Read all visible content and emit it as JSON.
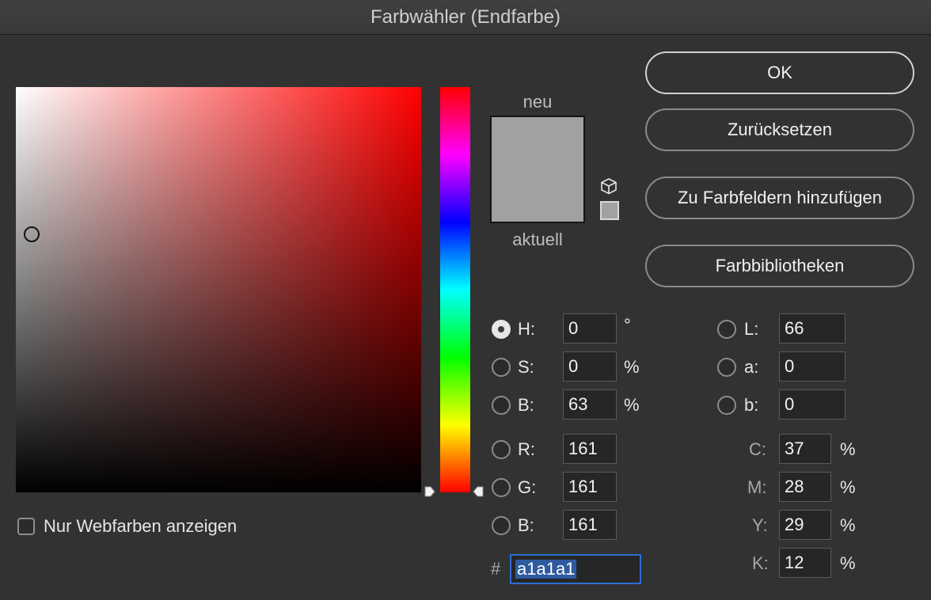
{
  "window": {
    "title": "Farbwähler (Endfarbe)"
  },
  "preview": {
    "new_label": "neu",
    "current_label": "aktuell",
    "new_color": "#a1a1a1",
    "current_color": "#a1a1a1"
  },
  "buttons": {
    "ok": "OK",
    "reset": "Zurücksetzen",
    "add_to_swatches": "Zu Farbfeldern hinzufügen",
    "color_libraries": "Farbbibliotheken"
  },
  "hsb": {
    "h": {
      "label": "H:",
      "value": "0",
      "unit": "°"
    },
    "s": {
      "label": "S:",
      "value": "0",
      "unit": "%"
    },
    "b": {
      "label": "B:",
      "value": "63",
      "unit": "%"
    }
  },
  "rgb": {
    "r": {
      "label": "R:",
      "value": "161"
    },
    "g": {
      "label": "G:",
      "value": "161"
    },
    "b": {
      "label": "B:",
      "value": "161"
    }
  },
  "lab": {
    "l": {
      "label": "L:",
      "value": "66"
    },
    "a": {
      "label": "a:",
      "value": "0"
    },
    "b": {
      "label": "b:",
      "value": "0"
    }
  },
  "cmyk": {
    "c": {
      "label": "C:",
      "value": "37",
      "unit": "%"
    },
    "m": {
      "label": "M:",
      "value": "28",
      "unit": "%"
    },
    "y": {
      "label": "Y:",
      "value": "29",
      "unit": "%"
    },
    "k": {
      "label": "K:",
      "value": "12",
      "unit": "%"
    }
  },
  "hex": {
    "label": "#",
    "value": "a1a1a1"
  },
  "web_only": {
    "label": "Nur Webfarben anzeigen",
    "checked": false
  },
  "icons": {
    "gamut": "cube-icon",
    "swatch": "websafe-swatch-icon"
  },
  "selected_channel": "H"
}
